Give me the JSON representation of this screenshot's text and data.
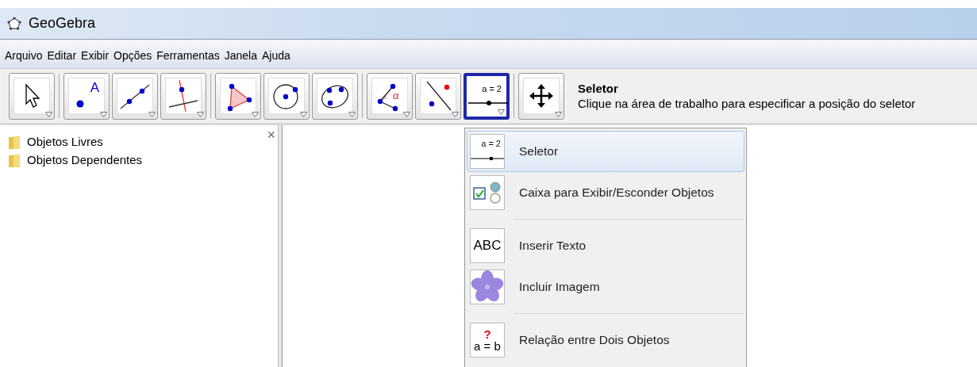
{
  "window": {
    "title": "GeoGebra"
  },
  "menu_bar": [
    "Arquivo",
    "Editar",
    "Exibir",
    "Opções",
    "Ferramentas",
    "Janela",
    "Ajuda"
  ],
  "toolbar": {
    "groups": [
      [
        {
          "kind": "move",
          "selected": false
        }
      ],
      [
        {
          "kind": "point",
          "label": "A",
          "selected": false
        },
        {
          "kind": "line",
          "selected": false
        },
        {
          "kind": "perpendicular",
          "selected": false
        }
      ],
      [
        {
          "kind": "polygon",
          "selected": false
        },
        {
          "kind": "circle",
          "selected": false
        },
        {
          "kind": "conic",
          "selected": false
        }
      ],
      [
        {
          "kind": "angle",
          "label": "α",
          "selected": false
        },
        {
          "kind": "reflect",
          "selected": false
        },
        {
          "kind": "slider",
          "label": "a = 2",
          "selected": true
        }
      ],
      [
        {
          "kind": "pan",
          "selected": false
        }
      ]
    ]
  },
  "tool_help": {
    "title": "Seletor",
    "description": "Clique na área de trabalho para especificar a posição do seletor"
  },
  "algebra_view": {
    "items": [
      "Objetos Livres",
      "Objetos Dependentes"
    ],
    "close": "×"
  },
  "dropdown": {
    "groups": [
      [
        {
          "kind": "slider",
          "icon_text": "a = 2",
          "label": "Seletor",
          "selected": true
        },
        {
          "kind": "checkbox",
          "label": "Caixa para Exibir/Esconder Objetos",
          "selected": false
        }
      ],
      [
        {
          "kind": "text",
          "icon_text": "ABC",
          "label": "Inserir Texto",
          "selected": false
        },
        {
          "kind": "image",
          "label": "Incluir Imagem",
          "selected": false
        }
      ],
      [
        {
          "kind": "relation",
          "icon_mark": "?",
          "icon_text": "a = b",
          "label": "Relação entre Dois Objetos",
          "selected": false
        }
      ]
    ]
  }
}
